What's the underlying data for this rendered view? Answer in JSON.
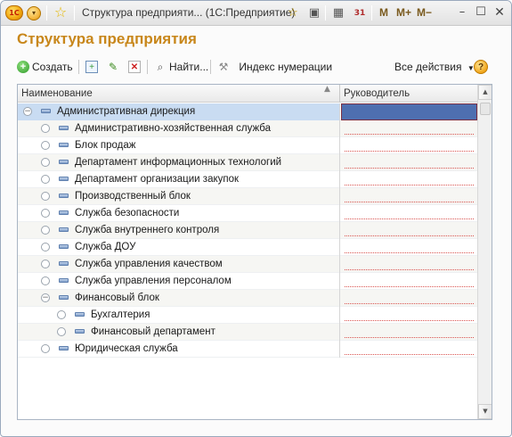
{
  "window": {
    "title": "Структура предприяти... (1С:Предприятие)",
    "memory_buttons": [
      "M",
      "M+",
      "M−"
    ],
    "calendar_day": "31"
  },
  "page": {
    "title": "Структура предприятия"
  },
  "toolbar": {
    "create_label": "Создать",
    "find_label": "Найти...",
    "index_label": "Индекс нумерации",
    "all_actions_label": "Все действия",
    "help_glyph": "?"
  },
  "grid": {
    "columns": [
      "Наименование",
      "Руководитель"
    ],
    "rows": [
      {
        "label": "Административная дирекция",
        "level": 0,
        "node": "collapse",
        "manager": ""
      },
      {
        "label": "Административно-хозяйственная служба",
        "level": 1,
        "node": "leaf",
        "manager": ""
      },
      {
        "label": "Блок продаж",
        "level": 1,
        "node": "leaf",
        "manager": ""
      },
      {
        "label": "Департамент информационных технологий",
        "level": 1,
        "node": "leaf",
        "manager": ""
      },
      {
        "label": "Департамент организации закупок",
        "level": 1,
        "node": "leaf",
        "manager": ""
      },
      {
        "label": "Производственный блок",
        "level": 1,
        "node": "leaf",
        "manager": ""
      },
      {
        "label": "Служба безопасности",
        "level": 1,
        "node": "leaf",
        "manager": ""
      },
      {
        "label": "Служба внутреннего контроля",
        "level": 1,
        "node": "leaf",
        "manager": ""
      },
      {
        "label": "Служба ДОУ",
        "level": 1,
        "node": "leaf",
        "manager": ""
      },
      {
        "label": "Служба управления качеством",
        "level": 1,
        "node": "leaf",
        "manager": ""
      },
      {
        "label": "Служба управления персоналом",
        "level": 1,
        "node": "leaf",
        "manager": ""
      },
      {
        "label": "Финансовый блок",
        "level": 1,
        "node": "collapse",
        "manager": ""
      },
      {
        "label": "Бухгалтерия",
        "level": 2,
        "node": "leaf",
        "manager": ""
      },
      {
        "label": "Финансовый департамент",
        "level": 2,
        "node": "leaf",
        "manager": ""
      },
      {
        "label": "Юридическая служба",
        "level": 1,
        "node": "leaf",
        "manager": ""
      }
    ]
  },
  "colors": {
    "title": "#c8871b",
    "selected_cell": "#4e6fb0",
    "selected_row": "#c9dcf2"
  },
  "icons": {
    "app_logo": "1c-logo-icon",
    "main_menu": "main-menu-icon",
    "favorite": "star-icon",
    "history": "history-icon",
    "link": "link-icon",
    "calculator": "calculator-icon",
    "calendar": "calendar-icon",
    "minimize": "minimize-icon",
    "maximize": "maximize-icon",
    "close": "close-icon"
  }
}
